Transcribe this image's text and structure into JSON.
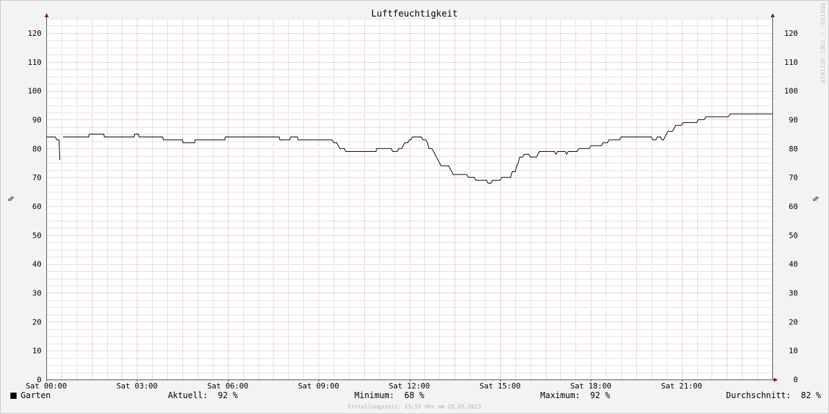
{
  "watermark": "RRDTOOL / TOBI OETIKER",
  "footer": "Erstellungszeit: 23:55 Uhr am 25.03.2023",
  "legend": {
    "series_name": "Garten",
    "current_label": "Aktuell:",
    "current_value": "92 %",
    "min_label": "Minimum:",
    "min_value": "68 %",
    "max_label": "Maximum:",
    "max_value": "92 %",
    "avg_label": "Durchschnitt:",
    "avg_value": "82 %"
  },
  "colors": {
    "line": "#000000",
    "major_grid": "#f0a0b8",
    "minor_grid": "#c8c8c8",
    "axis_arrow": "#8b1a1a"
  },
  "chart_data": {
    "type": "line",
    "title": "Luftfeuchtigkeit",
    "ylabel": "%",
    "ylim": [
      0,
      125
    ],
    "xlim_hours": [
      0,
      24
    ],
    "yticks": [
      "0",
      "10",
      "20",
      "30",
      "40",
      "50",
      "60",
      "70",
      "80",
      "90",
      "100",
      "110",
      "120"
    ],
    "xticks": [
      {
        "label": "Sat 00:00",
        "hour": 0
      },
      {
        "label": "Sat 03:00",
        "hour": 3
      },
      {
        "label": "Sat 06:00",
        "hour": 6
      },
      {
        "label": "Sat 09:00",
        "hour": 9
      },
      {
        "label": "Sat 12:00",
        "hour": 12
      },
      {
        "label": "Sat 15:00",
        "hour": 15
      },
      {
        "label": "Sat 18:00",
        "hour": 18
      },
      {
        "label": "Sat 21:00",
        "hour": 21
      }
    ],
    "grid": true,
    "series": [
      {
        "name": "Garten",
        "segments": [
          [
            [
              0,
              84
            ],
            [
              0.3,
              84
            ],
            [
              0.35,
              83
            ],
            [
              0.42,
              83
            ],
            [
              0.45,
              76
            ]
          ],
          [
            [
              0.55,
              84
            ],
            [
              1.4,
              84
            ],
            [
              1.42,
              85
            ],
            [
              1.9,
              85
            ],
            [
              1.92,
              84
            ],
            [
              2.9,
              84
            ],
            [
              2.92,
              85
            ],
            [
              3.05,
              85
            ],
            [
              3.07,
              84
            ],
            [
              3.85,
              84
            ],
            [
              3.87,
              83
            ],
            [
              4.5,
              83
            ],
            [
              4.52,
              82
            ],
            [
              4.9,
              82
            ],
            [
              4.92,
              83
            ],
            [
              5.9,
              83
            ],
            [
              5.92,
              84
            ],
            [
              7.7,
              84
            ],
            [
              7.72,
              83
            ],
            [
              8.05,
              83
            ],
            [
              8.07,
              84
            ],
            [
              8.3,
              84
            ],
            [
              8.32,
              83
            ],
            [
              9.45,
              83
            ],
            [
              9.5,
              82
            ],
            [
              9.6,
              82
            ],
            [
              9.65,
              81
            ],
            [
              9.7,
              80
            ],
            [
              9.85,
              80
            ],
            [
              9.9,
              79
            ],
            [
              10.9,
              79
            ],
            [
              10.92,
              80
            ],
            [
              11.4,
              80
            ],
            [
              11.45,
              79
            ],
            [
              11.6,
              79
            ],
            [
              11.65,
              80
            ],
            [
              11.75,
              80
            ],
            [
              11.8,
              81
            ],
            [
              11.85,
              82
            ],
            [
              11.95,
              82
            ],
            [
              12.0,
              83
            ],
            [
              12.05,
              83
            ],
            [
              12.1,
              84
            ],
            [
              12.4,
              84
            ],
            [
              12.45,
              83
            ],
            [
              12.55,
              83
            ],
            [
              12.6,
              82
            ],
            [
              12.65,
              80
            ],
            [
              12.75,
              80
            ],
            [
              12.8,
              79
            ],
            [
              12.85,
              78
            ],
            [
              12.9,
              77
            ],
            [
              12.95,
              76
            ],
            [
              13.0,
              75
            ],
            [
              13.05,
              74
            ],
            [
              13.3,
              74
            ],
            [
              13.35,
              73
            ],
            [
              13.4,
              72
            ],
            [
              13.45,
              71
            ],
            [
              13.9,
              71
            ],
            [
              13.95,
              70
            ],
            [
              14.15,
              70
            ],
            [
              14.2,
              69
            ],
            [
              14.55,
              69
            ],
            [
              14.6,
              68
            ],
            [
              14.7,
              68
            ],
            [
              14.75,
              69
            ],
            [
              15.0,
              69
            ],
            [
              15.05,
              70
            ],
            [
              15.35,
              70
            ],
            [
              15.4,
              72
            ],
            [
              15.5,
              72
            ],
            [
              15.55,
              74
            ],
            [
              15.6,
              75
            ],
            [
              15.65,
              77
            ],
            [
              15.75,
              77
            ],
            [
              15.8,
              78
            ],
            [
              15.95,
              78
            ],
            [
              16.0,
              77
            ],
            [
              16.2,
              77
            ],
            [
              16.25,
              78
            ],
            [
              16.3,
              79
            ],
            [
              16.8,
              79
            ],
            [
              16.85,
              78
            ],
            [
              16.9,
              79
            ],
            [
              17.15,
              79
            ],
            [
              17.2,
              78
            ],
            [
              17.25,
              79
            ],
            [
              17.55,
              79
            ],
            [
              17.6,
              80
            ],
            [
              17.95,
              80
            ],
            [
              18.0,
              81
            ],
            [
              18.35,
              81
            ],
            [
              18.4,
              82
            ],
            [
              18.55,
              82
            ],
            [
              18.6,
              83
            ],
            [
              18.95,
              83
            ],
            [
              19.0,
              84
            ],
            [
              20.0,
              84
            ],
            [
              20.05,
              83
            ],
            [
              20.15,
              83
            ],
            [
              20.2,
              84
            ],
            [
              20.3,
              84
            ],
            [
              20.35,
              83
            ],
            [
              20.4,
              83
            ],
            [
              20.45,
              84
            ],
            [
              20.5,
              85
            ],
            [
              20.55,
              86
            ],
            [
              20.7,
              86
            ],
            [
              20.75,
              87
            ],
            [
              20.8,
              88
            ],
            [
              21.0,
              88
            ],
            [
              21.05,
              89
            ],
            [
              21.5,
              89
            ],
            [
              21.55,
              90
            ],
            [
              21.75,
              90
            ],
            [
              21.8,
              91
            ],
            [
              22.55,
              91
            ],
            [
              22.6,
              92
            ],
            [
              24.0,
              92
            ]
          ]
        ]
      }
    ]
  }
}
